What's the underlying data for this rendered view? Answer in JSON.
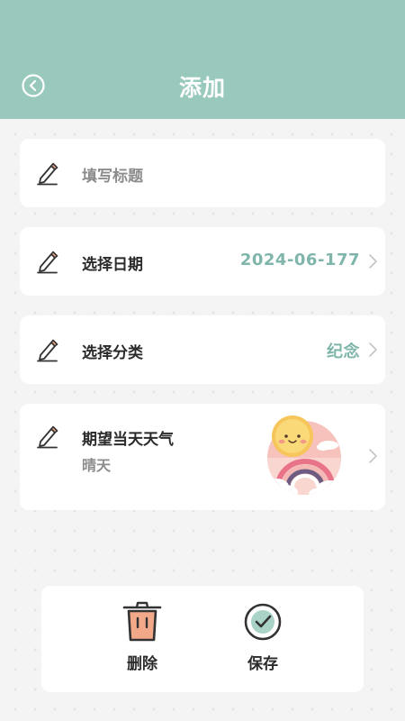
{
  "header": {
    "title": "添加",
    "back_icon": "back-circle-icon",
    "background": "#99c9bd"
  },
  "form": {
    "title_row": {
      "placeholder": "填写标题",
      "icon": "pencil-icon"
    },
    "date_row": {
      "label": "选择日期",
      "value": "2024-06-177",
      "icon": "pencil-icon"
    },
    "category_row": {
      "label": "选择分类",
      "value": "纪念",
      "icon": "pencil-icon"
    },
    "weather_row": {
      "label": "期望当天天气",
      "value": "晴天",
      "icon": "pencil-icon",
      "image": "sun-rainbow-weather-illustration"
    }
  },
  "actions": {
    "delete_label": "删除",
    "delete_icon": "trash-icon",
    "save_label": "保存",
    "save_icon": "check-circle-icon"
  },
  "colors": {
    "accent": "#7fb5aa",
    "header": "#99c9bd",
    "trash_fill": "#f2a98a"
  }
}
